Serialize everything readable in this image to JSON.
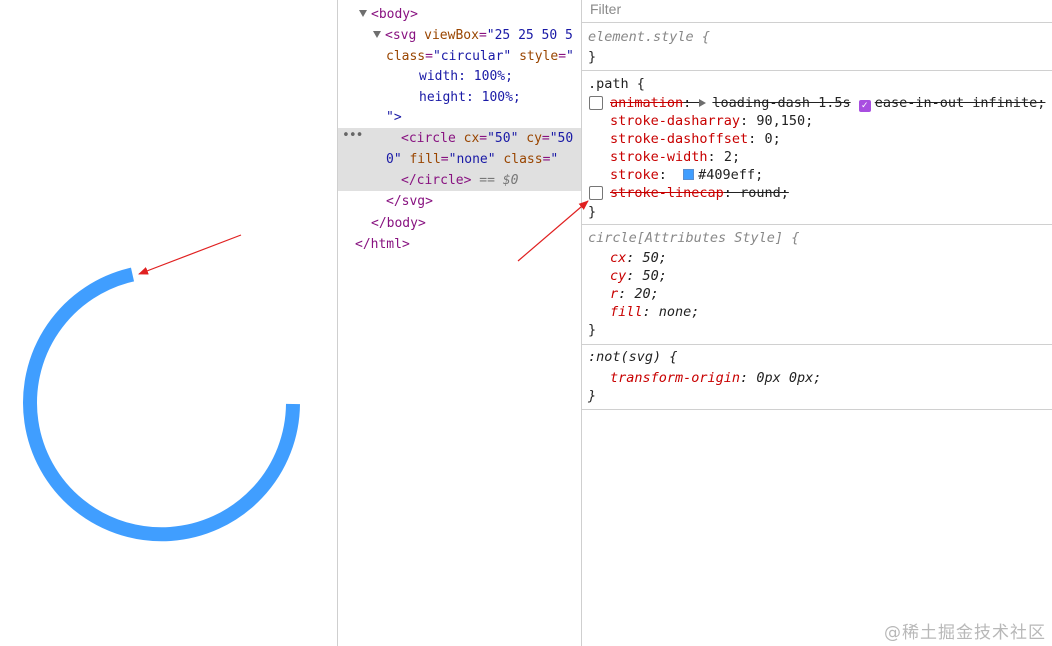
{
  "preview": {
    "stroke_color": "#409eff"
  },
  "elements": {
    "lines": [
      {
        "open": "<",
        "tag": "body",
        "close": ">"
      },
      {
        "open": "<",
        "tag": "svg",
        "attr": "viewBox",
        "eq": "=",
        "val": "\"25 25 50 5"
      },
      {
        "attr": "class",
        "eq": "=",
        "val": "\"circular\"",
        "attr2": "style",
        "eq2": "=",
        "val2": "\""
      },
      {
        "text": "width: 100%;"
      },
      {
        "text": "height: 100%;"
      },
      {
        "text": "\">"
      },
      {
        "open": "<",
        "tag": "circle",
        "attr": "cx",
        "eq": "=",
        "val": "\"50\"",
        "attr2": "cy",
        "eq2": "=",
        "val2": "\"50"
      },
      {
        "pre": "0\"",
        "attr": "fill",
        "eq": "=",
        "val": "\"none\"",
        "attr2": "class",
        "eq2": "=",
        "val2": "\""
      },
      {
        "open": "</",
        "tag": "circle",
        "close": ">",
        "marker": "== $0"
      },
      {
        "open": "</",
        "tag": "svg",
        "close": ">"
      },
      {
        "open": "</",
        "tag": "body",
        "close": ">"
      },
      {
        "open": "</",
        "tag": "html",
        "close": ">"
      }
    ],
    "dots": "•••"
  },
  "styles": {
    "filter_placeholder": "Filter",
    "rule_element": {
      "selector": "element.style {",
      "close": "}"
    },
    "rule_path": {
      "selector": ".path {",
      "close": "}",
      "props": [
        {
          "name": "animation",
          "value": "loading-dash 1.5s",
          "value2": "ease-in-out infinite;",
          "struck": true,
          "checkbox": true
        },
        {
          "name": "stroke-dasharray",
          "value": "90,150;"
        },
        {
          "name": "stroke-dashoffset",
          "value": "0;"
        },
        {
          "name": "stroke-width",
          "value": "2;"
        },
        {
          "name": "stroke",
          "value": "#409eff;",
          "swatch": "#409eff"
        },
        {
          "name": "stroke-linecap",
          "value": "round;",
          "struck": true,
          "checkbox": true
        }
      ]
    },
    "rule_circle": {
      "selector": "circle[Attributes Style] {",
      "close": "}",
      "props": [
        {
          "name": "cx",
          "value": "50;"
        },
        {
          "name": "cy",
          "value": "50;"
        },
        {
          "name": "r",
          "value": "20;"
        },
        {
          "name": "fill",
          "value": "none;"
        }
      ]
    },
    "rule_not": {
      "selector": ":not(svg) {",
      "close": "}",
      "props": [
        {
          "name": "transform-origin",
          "value": "0px 0px;"
        }
      ]
    }
  },
  "watermark": "@稀土掘金技术社区",
  "colors": {
    "arrow": "#e02020",
    "accent": "#409eff"
  }
}
